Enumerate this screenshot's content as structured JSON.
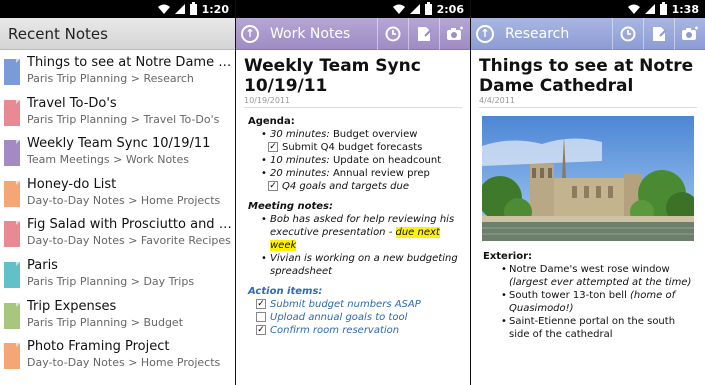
{
  "screens": [
    {
      "time": "1:20"
    },
    {
      "time": "2:06"
    },
    {
      "time": "1:38"
    }
  ],
  "recent": {
    "title": "Recent Notes",
    "items": [
      {
        "title": "Things to see at Notre Dame Cat…",
        "path": "Paris Trip Planning > Research",
        "color": "#7a9ad8"
      },
      {
        "title": "Travel To-Do's",
        "path": "Paris Trip Planning > Travel To-Do's",
        "color": "#e88a94"
      },
      {
        "title": "Weekly Team Sync 10/19/11",
        "path": "Team Meetings > Work Notes",
        "color": "#a38ac4"
      },
      {
        "title": "Honey-do List",
        "path": "Day-to-Day Notes > Home Projects",
        "color": "#f4a676"
      },
      {
        "title": "Fig Salad with Prosciutto and Wa…",
        "path": "Day-to-Day Notes > Favorite Recipes",
        "color": "#e88a94"
      },
      {
        "title": "Paris",
        "path": "Paris Trip Planning > Day Trips",
        "color": "#62c0c8"
      },
      {
        "title": "Trip Expenses",
        "path": "Paris Trip Planning > Budget",
        "color": "#a8c67c"
      },
      {
        "title": "Photo Framing Project",
        "path": "Day-to-Day Notes > Home Projects",
        "color": "#f4a676"
      }
    ]
  },
  "work": {
    "section": "Work Notes",
    "title": "Weekly Team Sync 10/19/11",
    "date": "10/19/2011",
    "agenda_label": "Agenda:",
    "agenda": [
      {
        "em": "30 minutes:",
        "text": " Budget overview"
      },
      {
        "em": "10 minutes:",
        "text": " Update on headcount"
      },
      {
        "em": "20 minutes:",
        "text": " Annual review prep"
      }
    ],
    "agenda_task1": "Submit Q4 budget forecasts",
    "agenda_task2": "Q4 goals and targets due",
    "meeting_label": "Meeting notes:",
    "meeting1_a": "Bob has asked for help reviewing his executive presentation - ",
    "meeting1_hl": "due next week",
    "meeting2": "Vivian is working on a new budgeting spreadsheet",
    "actions_label": "Action items:",
    "actions": [
      {
        "text": "Submit budget numbers ASAP",
        "checked": true
      },
      {
        "text": "Upload annual goals to tool",
        "checked": false
      },
      {
        "text": "Confirm room reservation",
        "checked": true
      }
    ]
  },
  "research": {
    "section": "Research",
    "title": "Things to see at Notre Dame Cathedral",
    "date": "4/4/2011",
    "exterior_label": "Exterior:",
    "b1": "Notre Dame's west rose window",
    "b1_it": "(largest ever attempted at the time)",
    "b2": "South tower 13-ton bell ",
    "b2_it": "(home of Quasimodo!)",
    "b3": "Saint-Etienne portal on the south side of the cathedral"
  },
  "colors": {
    "work_bar": "#a796c9",
    "research_bar": "#99a7db",
    "highlight": "#fff200",
    "link_blue": "#2d6ab4"
  }
}
